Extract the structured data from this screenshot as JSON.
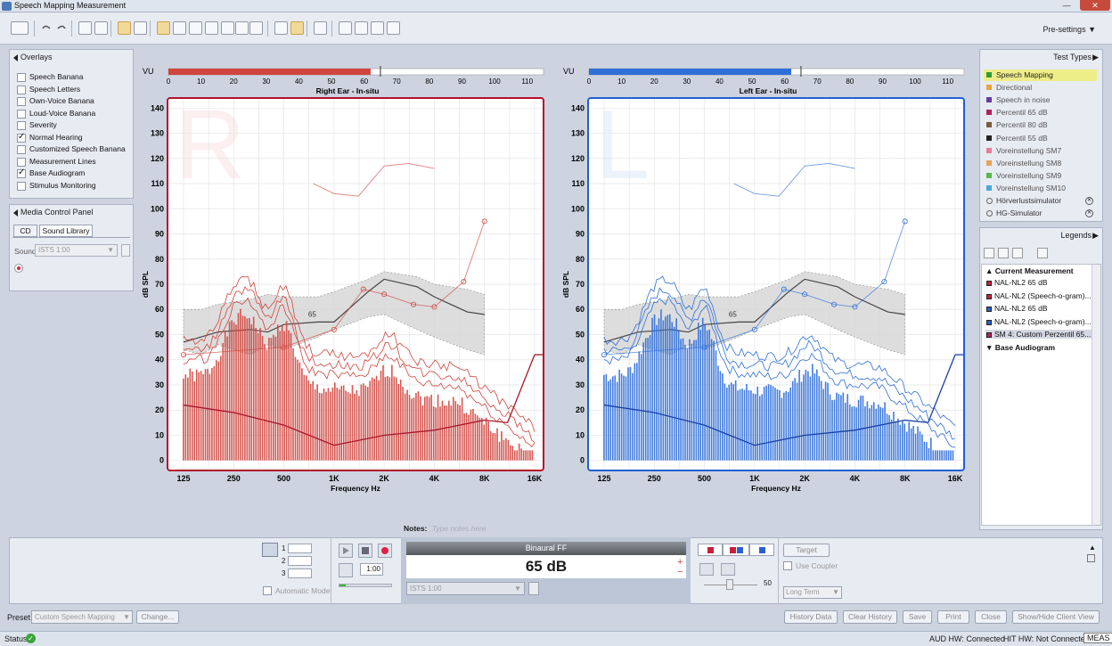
{
  "window": {
    "title": "Speech Mapping Measurement"
  },
  "toolbar": {
    "presettings_label": "Pre-settings"
  },
  "overlays": {
    "header": "Overlays",
    "items": [
      {
        "label": "Speech Banana",
        "checked": false
      },
      {
        "label": "Speech Letters",
        "checked": false
      },
      {
        "label": "Own-Voice Banana",
        "checked": false
      },
      {
        "label": "Loud-Voice Banana",
        "checked": false
      },
      {
        "label": "Severity",
        "checked": false
      },
      {
        "label": "Normal Hearing",
        "checked": true
      },
      {
        "label": "Customized Speech Banana",
        "checked": false
      },
      {
        "label": "Measurement Lines",
        "checked": false
      },
      {
        "label": "Base Audiogram",
        "checked": true
      },
      {
        "label": "Stimulus Monitoring",
        "checked": false
      }
    ]
  },
  "media": {
    "header": "Media Control Panel",
    "tabs": [
      "CD",
      "Sound Library"
    ],
    "sound_label": "Sound",
    "sound_value": "ISTS 1:00"
  },
  "charts": {
    "vu_label": "VU",
    "vu_ticks": [
      "0",
      "10",
      "20",
      "30",
      "40",
      "50",
      "60",
      "70",
      "80",
      "90",
      "100",
      "110"
    ],
    "y_label": "dB SPL",
    "y_ticks": [
      "140",
      "130",
      "120",
      "110",
      "100",
      "90",
      "80",
      "70",
      "60",
      "50",
      "40",
      "30",
      "20",
      "10",
      "0"
    ],
    "x_label": "Frequency Hz",
    "x_ticks": [
      "125",
      "250",
      "500",
      "1K",
      "2K",
      "4K",
      "8K",
      "16K"
    ],
    "right": {
      "title": "Right Ear - In-situ",
      "letter": "R",
      "color": "#d0463f",
      "vu_level": 62,
      "mark": "65"
    },
    "left": {
      "title": "Left Ear - In-situ",
      "letter": "L",
      "color": "#2f6fd8",
      "vu_level": 62,
      "mark": "65"
    }
  },
  "test_types": {
    "header": "Test Types",
    "items": [
      {
        "label": "Speech Mapping",
        "color": "#2e9c3a",
        "selected": true
      },
      {
        "label": "Directional",
        "color": "#e8a33b"
      },
      {
        "label": "Speech in noise",
        "color": "#6a3aa0"
      },
      {
        "label": "Percentil 65 dB",
        "color": "#b0235a"
      },
      {
        "label": "Percentil 80 dB",
        "color": "#7a5a3a"
      },
      {
        "label": "Percentil 55 dB",
        "color": "#222222"
      },
      {
        "label": "Voreinstellung SM7",
        "color": "#e87c9a"
      },
      {
        "label": "Voreinstellung SM8",
        "color": "#e8a05a"
      },
      {
        "label": "Voreinstellung SM9",
        "color": "#5ab84a"
      },
      {
        "label": "Voreinstellung SM10",
        "color": "#4aa8d8"
      },
      {
        "label": "Hörverlustsimulator",
        "color": ""
      },
      {
        "label": "HG-Simulator",
        "color": ""
      }
    ]
  },
  "legends": {
    "header": "Legends",
    "group1": "Current Measurement",
    "items": [
      "NAL-NL2 65 dB",
      "NAL-NL2 (Speech-o-gram)...",
      "NAL-NL2 65 dB",
      "NAL-NL2 (Speech-o-gram)...",
      "SM 4: Custom Perzentil 65..."
    ],
    "group2": "Base Audiogram"
  },
  "notes": {
    "label": "Notes:",
    "placeholder": "Type notes here"
  },
  "bottom": {
    "slots": [
      "1",
      "2",
      "3"
    ],
    "auto_mode": "Automatic Mode",
    "time": "1:00",
    "stimulus_title": "Binaural FF",
    "level": "65 dB",
    "stimulus_value": "ISTS 1:00",
    "target_btn": "Target",
    "use_coupler": "Use Coupler",
    "volume": "50",
    "term_value": "Long Term"
  },
  "footer": {
    "preset_label": "Preset",
    "preset_value": "Custom Speech Mapping",
    "change_btn": "Change...",
    "buttons": [
      "History Data",
      "Clear History",
      "Save",
      "Print",
      "Close",
      "Show/Hide Client View"
    ]
  },
  "status": {
    "label": "Status",
    "aud_label": "AUD HW:",
    "aud_value": "Connected",
    "hit_label": "HIT HW:",
    "hit_value": "Not Connected",
    "meas": "MEAS"
  }
}
